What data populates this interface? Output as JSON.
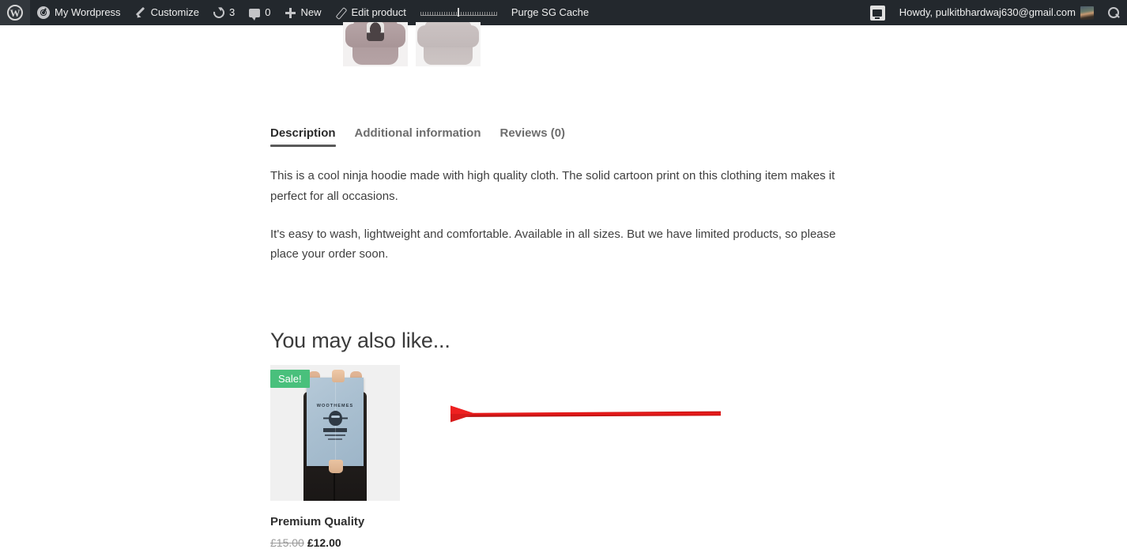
{
  "adminbar": {
    "wp_logo_label": "W",
    "items": [
      {
        "name": "site-name",
        "icon": "dashboard-icon",
        "label": "My Wordpress"
      },
      {
        "name": "customize",
        "icon": "paintbrush-icon",
        "label": "Customize"
      },
      {
        "name": "updates",
        "icon": "update-icon",
        "label": "3"
      },
      {
        "name": "comments",
        "icon": "comment-icon",
        "label": "0"
      },
      {
        "name": "new-content",
        "icon": "plus-icon",
        "label": "New"
      },
      {
        "name": "edit-product",
        "icon": "pencil-icon",
        "label": "Edit product"
      }
    ],
    "purge_label": "Purge SG Cache",
    "howdy": "Howdy, pulkitbhardwaj630@gmail.com",
    "search_icon": "search-icon",
    "monitor_icon": "monitor-icon",
    "avatar_icon": "user-avatar"
  },
  "gallery": {
    "thumbs": [
      {
        "name": "thumbnail-hoodie-front",
        "alt": "Ninja hoodie front"
      },
      {
        "name": "thumbnail-hoodie-back",
        "alt": "Hoodie back"
      }
    ]
  },
  "tabs": [
    {
      "label": "Description",
      "active": true
    },
    {
      "label": "Additional information",
      "active": false
    },
    {
      "label": "Reviews (0)",
      "active": false
    }
  ],
  "description": {
    "paragraph1": "This is a cool ninja hoodie made with high quality cloth. The solid cartoon print on this clothing item makes it perfect for all occasions.",
    "paragraph2": "It's easy to wash, lightweight and comfortable. Available in all sizes. But we have limited products, so please place your order soon."
  },
  "upsells": {
    "heading": "You may also like...",
    "products": [
      {
        "name": "Premium Quality",
        "badge": "Sale!",
        "price_old": "£15.00",
        "price_new": "£12.00",
        "poster_text": "WOOTHEMES"
      }
    ]
  },
  "annotation": {
    "type": "arrow",
    "color": "#d71a1a",
    "direction": "left"
  }
}
